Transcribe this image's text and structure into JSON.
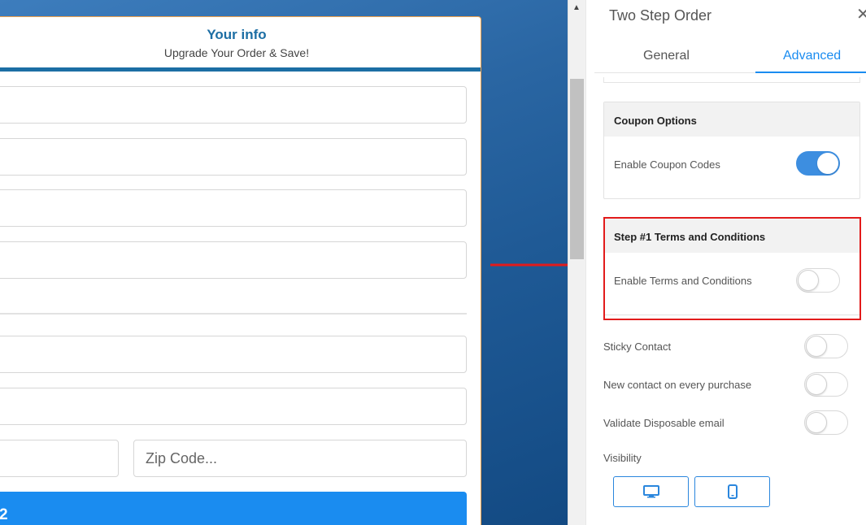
{
  "form": {
    "title": "Your info",
    "subtitle": "Upgrade Your Order & Save!",
    "zip_placeholder": "Zip Code...",
    "submit_label": "2"
  },
  "panel": {
    "title": "Two Step Order",
    "tabs": [
      {
        "label": "General",
        "active": false
      },
      {
        "label": "Advanced",
        "active": true
      }
    ],
    "coupon": {
      "header": "Coupon Options",
      "enable_label": "Enable Coupon Codes",
      "enabled": true
    },
    "terms": {
      "header": "Step #1 Terms and Conditions",
      "enable_label": "Enable Terms and Conditions",
      "enabled": false
    },
    "settings": [
      {
        "label": "Sticky Contact",
        "enabled": false
      },
      {
        "label": "New contact on every purchase",
        "enabled": false
      },
      {
        "label": "Validate Disposable email",
        "enabled": false
      }
    ],
    "visibility_label": "Visibility"
  },
  "icons": {
    "close": "close-icon",
    "desktop": "desktop-icon",
    "mobile": "mobile-icon",
    "scroll_up": "chevron-up-icon"
  },
  "colors": {
    "accent": "#1a8cf0",
    "highlight": "#e21b1b",
    "card_title": "#1c6ea4",
    "toggle_on": "#3d8ee0"
  }
}
